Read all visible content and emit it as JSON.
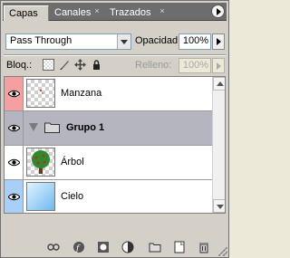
{
  "tabs": [
    {
      "label": "Capas",
      "active": true
    },
    {
      "label": "Canales",
      "active": false
    },
    {
      "label": "Trazados",
      "active": false
    }
  ],
  "tab_close_glyph": "×",
  "blend": {
    "mode": "Pass Through"
  },
  "opacity": {
    "label": "Opacidad:",
    "value": "100%"
  },
  "lock": {
    "label": "Bloq.:"
  },
  "fill": {
    "label": "Relleno:",
    "value": "100%"
  },
  "layers": [
    {
      "name": "Manzana",
      "visible": true,
      "eye_color": "#f4a0a0",
      "thumb": "transparent"
    },
    {
      "name": "Grupo 1",
      "type": "group",
      "visible": true,
      "selected": true,
      "collapsed": true
    },
    {
      "name": "Árbol",
      "visible": true,
      "thumb": "tree"
    },
    {
      "name": "Cielo",
      "visible": true,
      "eye_color": "#a8d0f6",
      "thumb": "sky"
    }
  ],
  "toolbar": [
    "link-icon",
    "fx-icon",
    "mask-icon",
    "adjustment-icon",
    "folder-icon",
    "new-layer-icon",
    "trash-icon"
  ]
}
